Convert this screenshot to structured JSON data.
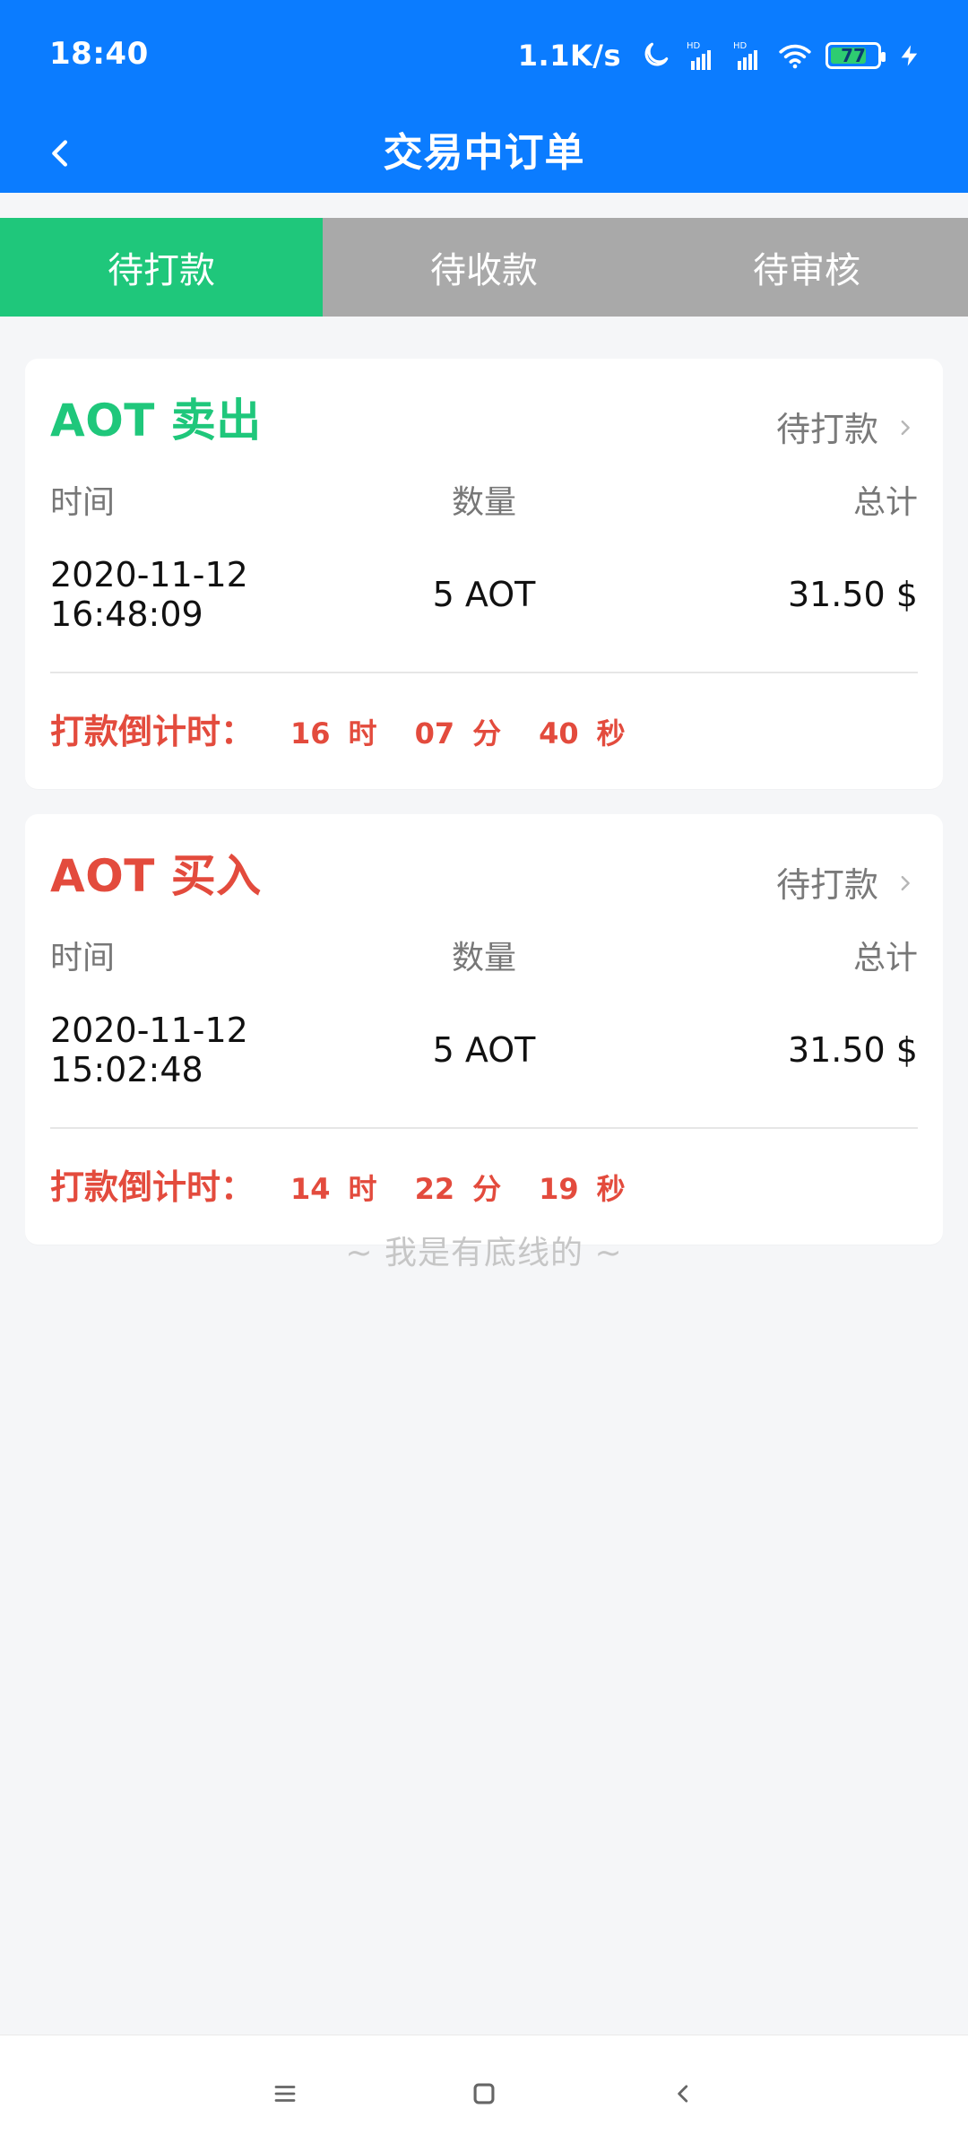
{
  "status_bar": {
    "time": "18:40",
    "speed": "1.1K/s",
    "battery": "77",
    "battery_level_percent": 77,
    "icons": [
      "moon-icon",
      "signal-hd-icon",
      "signal-hd-icon",
      "wifi-icon",
      "battery-icon",
      "charging-bolt-icon"
    ]
  },
  "header": {
    "title": "交易中订单",
    "back_icon": "chevron-left-icon"
  },
  "tabs": [
    {
      "label": "待打款",
      "active": true
    },
    {
      "label": "待收款",
      "active": false
    },
    {
      "label": "待审核",
      "active": false
    }
  ],
  "orders": [
    {
      "title": "AOT 卖出",
      "title_color": "#1fc77b",
      "status": "待打款",
      "labels": {
        "time": "时间",
        "qty": "数量",
        "total": "总计"
      },
      "values": {
        "time": "2020-11-12 16:48:09",
        "qty": "5 AOT",
        "total": "31.50 $"
      },
      "countdown": {
        "prefix": "打款倒计时：",
        "hours": "16",
        "hours_unit": "时",
        "minutes": "07",
        "minutes_unit": "分",
        "seconds": "40",
        "seconds_unit": "秒"
      }
    },
    {
      "title": "AOT 买入",
      "title_color": "#e34b3d",
      "status": "待打款",
      "labels": {
        "time": "时间",
        "qty": "数量",
        "total": "总计"
      },
      "values": {
        "time": "2020-11-12 15:02:48",
        "qty": "5 AOT",
        "total": "31.50 $"
      },
      "countdown": {
        "prefix": "打款倒计时：",
        "hours": "14",
        "hours_unit": "时",
        "minutes": "22",
        "minutes_unit": "分",
        "seconds": "19",
        "seconds_unit": "秒"
      }
    }
  ],
  "footer": {
    "end_text": "~ 我是有底线的 ~"
  },
  "nav": {
    "menu_icon": "menu-icon",
    "home_icon": "home-icon",
    "back_icon": "back-icon"
  },
  "colors": {
    "topbar": "#0b7cff",
    "tab_active": "#1fc77b",
    "tab_inactive": "#a9a9a9",
    "countdown": "#e34b3d"
  }
}
